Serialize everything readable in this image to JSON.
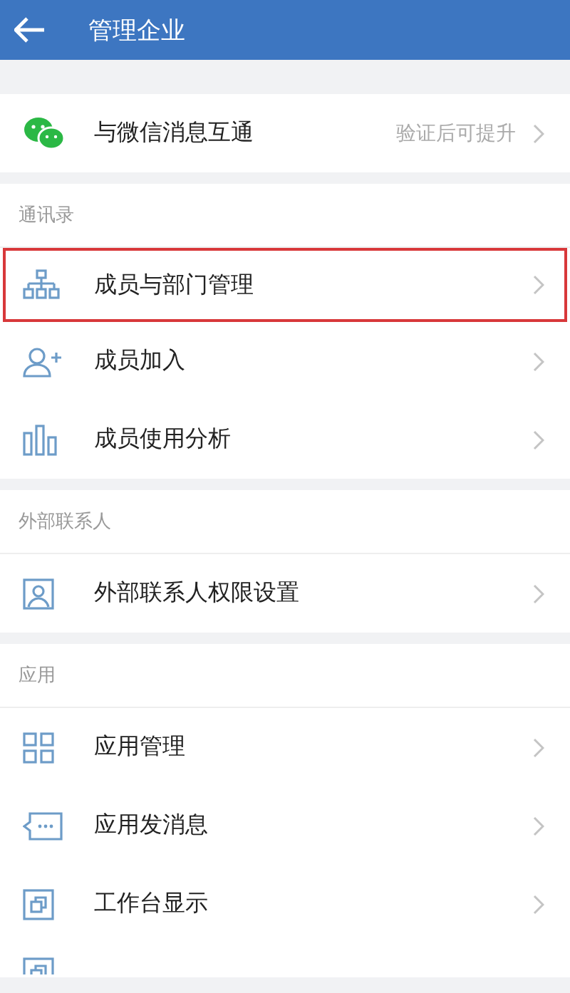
{
  "header": {
    "title": "管理企业"
  },
  "sections": [
    {
      "items": [
        {
          "kind": "wechat",
          "label": "与微信消息互通",
          "value": "验证后可提升",
          "highlighted": false
        }
      ]
    },
    {
      "title": "通讯录",
      "items": [
        {
          "kind": "org",
          "label": "成员与部门管理",
          "highlighted": true
        },
        {
          "kind": "personadd",
          "label": "成员加入",
          "highlighted": false
        },
        {
          "kind": "bars",
          "label": "成员使用分析",
          "highlighted": false
        }
      ]
    },
    {
      "title": "外部联系人",
      "items": [
        {
          "kind": "contact",
          "label": "外部联系人权限设置",
          "highlighted": false
        }
      ]
    },
    {
      "title": "应用",
      "items": [
        {
          "kind": "grid",
          "label": "应用管理",
          "highlighted": false
        },
        {
          "kind": "message",
          "label": "应用发消息",
          "highlighted": false
        },
        {
          "kind": "window",
          "label": "工作台显示",
          "highlighted": false
        },
        {
          "kind": "window",
          "partial": true,
          "highlighted": false
        }
      ]
    }
  ]
}
